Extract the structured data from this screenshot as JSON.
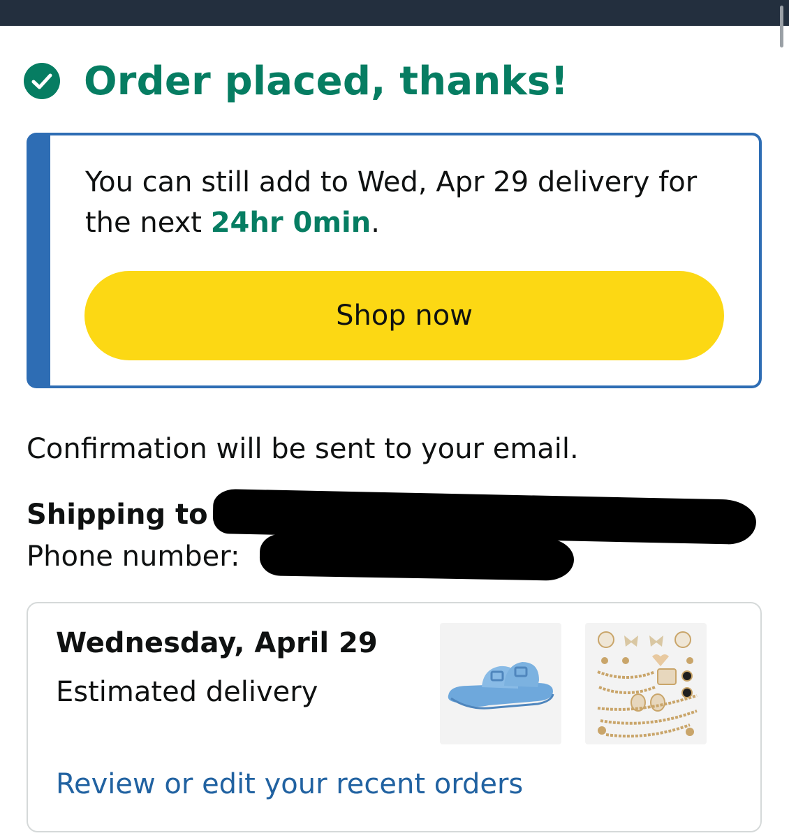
{
  "headline": {
    "text": "Order placed, thanks!",
    "icon": "check-circle-icon"
  },
  "promo": {
    "text_before": "You can still add to Wed, Apr 29 delivery for the next ",
    "time_left": "24hr 0min",
    "text_after": ".",
    "button_label": "Shop now"
  },
  "confirmation": {
    "text": "Confirmation will be sent to your email."
  },
  "shipping": {
    "label": "Shipping to",
    "phone_label": "Phone number:"
  },
  "delivery": {
    "date": "Wednesday, April 29",
    "label": "Estimated delivery",
    "items": [
      {
        "icon": "blue-sandal-image"
      },
      {
        "icon": "shoe-charms-image"
      }
    ],
    "review_link": "Review or edit your recent orders"
  },
  "colors": {
    "success_green": "#067d62",
    "promo_border": "#2e6db4",
    "button_yellow": "#fcd814",
    "link_blue": "#2162a1",
    "top_bar": "#232f3e"
  }
}
